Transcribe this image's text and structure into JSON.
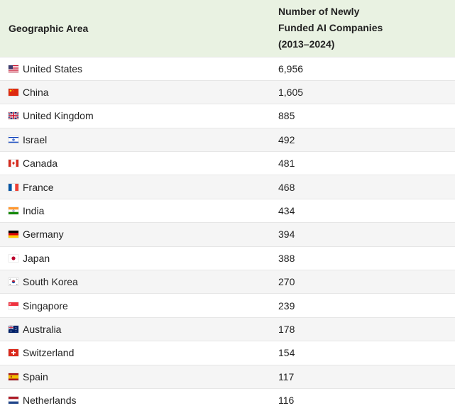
{
  "table": {
    "headers": {
      "area": "Geographic Area",
      "count_line1": "Number of Newly",
      "count_line2": "Funded AI Companies",
      "count_line3": "(2013–2024)"
    },
    "rows": [
      {
        "country": "United States",
        "count": "6,956",
        "flag": "us-flag-icon"
      },
      {
        "country": "China",
        "count": "1,605",
        "flag": "cn-flag-icon"
      },
      {
        "country": "United Kingdom",
        "count": "885",
        "flag": "gb-flag-icon"
      },
      {
        "country": "Israel",
        "count": "492",
        "flag": "il-flag-icon"
      },
      {
        "country": "Canada",
        "count": "481",
        "flag": "ca-flag-icon"
      },
      {
        "country": "France",
        "count": "468",
        "flag": "fr-flag-icon"
      },
      {
        "country": "India",
        "count": "434",
        "flag": "in-flag-icon"
      },
      {
        "country": "Germany",
        "count": "394",
        "flag": "de-flag-icon"
      },
      {
        "country": "Japan",
        "count": "388",
        "flag": "jp-flag-icon"
      },
      {
        "country": "South Korea",
        "count": "270",
        "flag": "kr-flag-icon"
      },
      {
        "country": "Singapore",
        "count": "239",
        "flag": "sg-flag-icon"
      },
      {
        "country": "Australia",
        "count": "178",
        "flag": "au-flag-icon"
      },
      {
        "country": "Switzerland",
        "count": "154",
        "flag": "ch-flag-icon"
      },
      {
        "country": "Spain",
        "count": "117",
        "flag": "es-flag-icon"
      },
      {
        "country": "Netherlands",
        "count": "116",
        "flag": "nl-flag-icon"
      }
    ]
  }
}
